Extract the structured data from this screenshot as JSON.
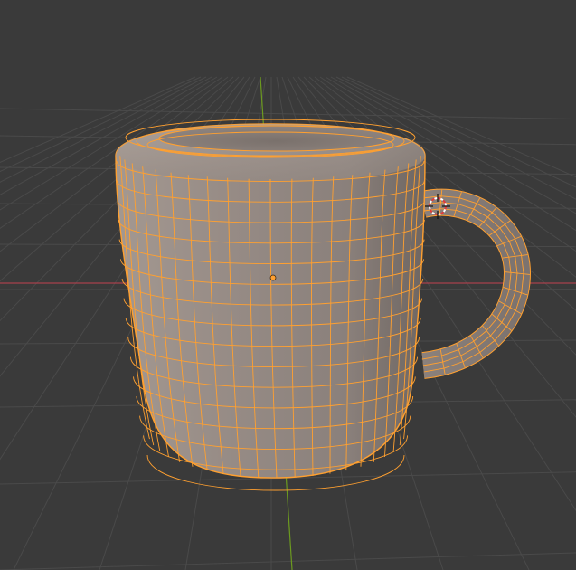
{
  "viewport": {
    "view": "3d-viewport-perspective",
    "mode": "edit-mode",
    "background_color": "#3a3a3a"
  },
  "colors": {
    "grid_line": "#4a4a4a",
    "x_axis": "#a8414c",
    "y_axis": "#6c9a1f",
    "z_axis": "#5f7f3b",
    "mesh_face": "#8f8580",
    "mesh_wire": "#ffa030",
    "origin_fill": "#ffa030",
    "origin_stroke": "#3a2a1a"
  },
  "scene": {
    "selected_object": "mug",
    "object_state": "all-selected",
    "wireframe_overlay": true,
    "cursor_3d": "visible-near-handle"
  }
}
